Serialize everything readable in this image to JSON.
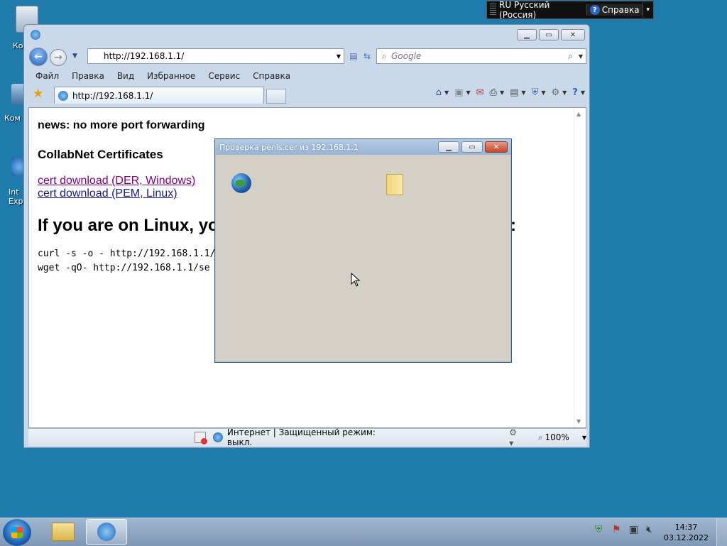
{
  "desktop": {
    "icons": [
      {
        "label": "Кор"
      },
      {
        "label": "Ком"
      },
      {
        "label": "Int\nExp"
      }
    ]
  },
  "langbar": {
    "language": "RU Русский (Россия)",
    "help": "Справка"
  },
  "ie": {
    "address_url": "http://192.168.1.1/",
    "search_placeholder": "Google",
    "menu": [
      "Файл",
      "Правка",
      "Вид",
      "Избранное",
      "Сервис",
      "Справка"
    ],
    "tab_title": "http://192.168.1.1/",
    "page": {
      "news": "news: no more port forwarding",
      "collabnet": "CollabNet Certificates",
      "link_der": "cert download (DER, Windows)",
      "link_pem": "cert download (PEM, Linux)",
      "linux_heading_left": "If you are on Linux, yo",
      "linux_heading_right": ":",
      "curl_cmd": "curl -s -o - http://192.168.1.1/",
      "wget_cmd": "wget -qO- http://192.168.1.1/se"
    },
    "status": {
      "zone": "Интернет | Защищенный режим: выкл.",
      "zoom": "100%"
    }
  },
  "dialog": {
    "title": "Проверка penis.cer из 192.168.1.1"
  },
  "taskbar": {
    "time": "14:37",
    "date": "03.12.2022"
  },
  "colors": {
    "desktop": "#1f7bab",
    "link_visited": "#800080",
    "link": "#1a1a8c"
  }
}
